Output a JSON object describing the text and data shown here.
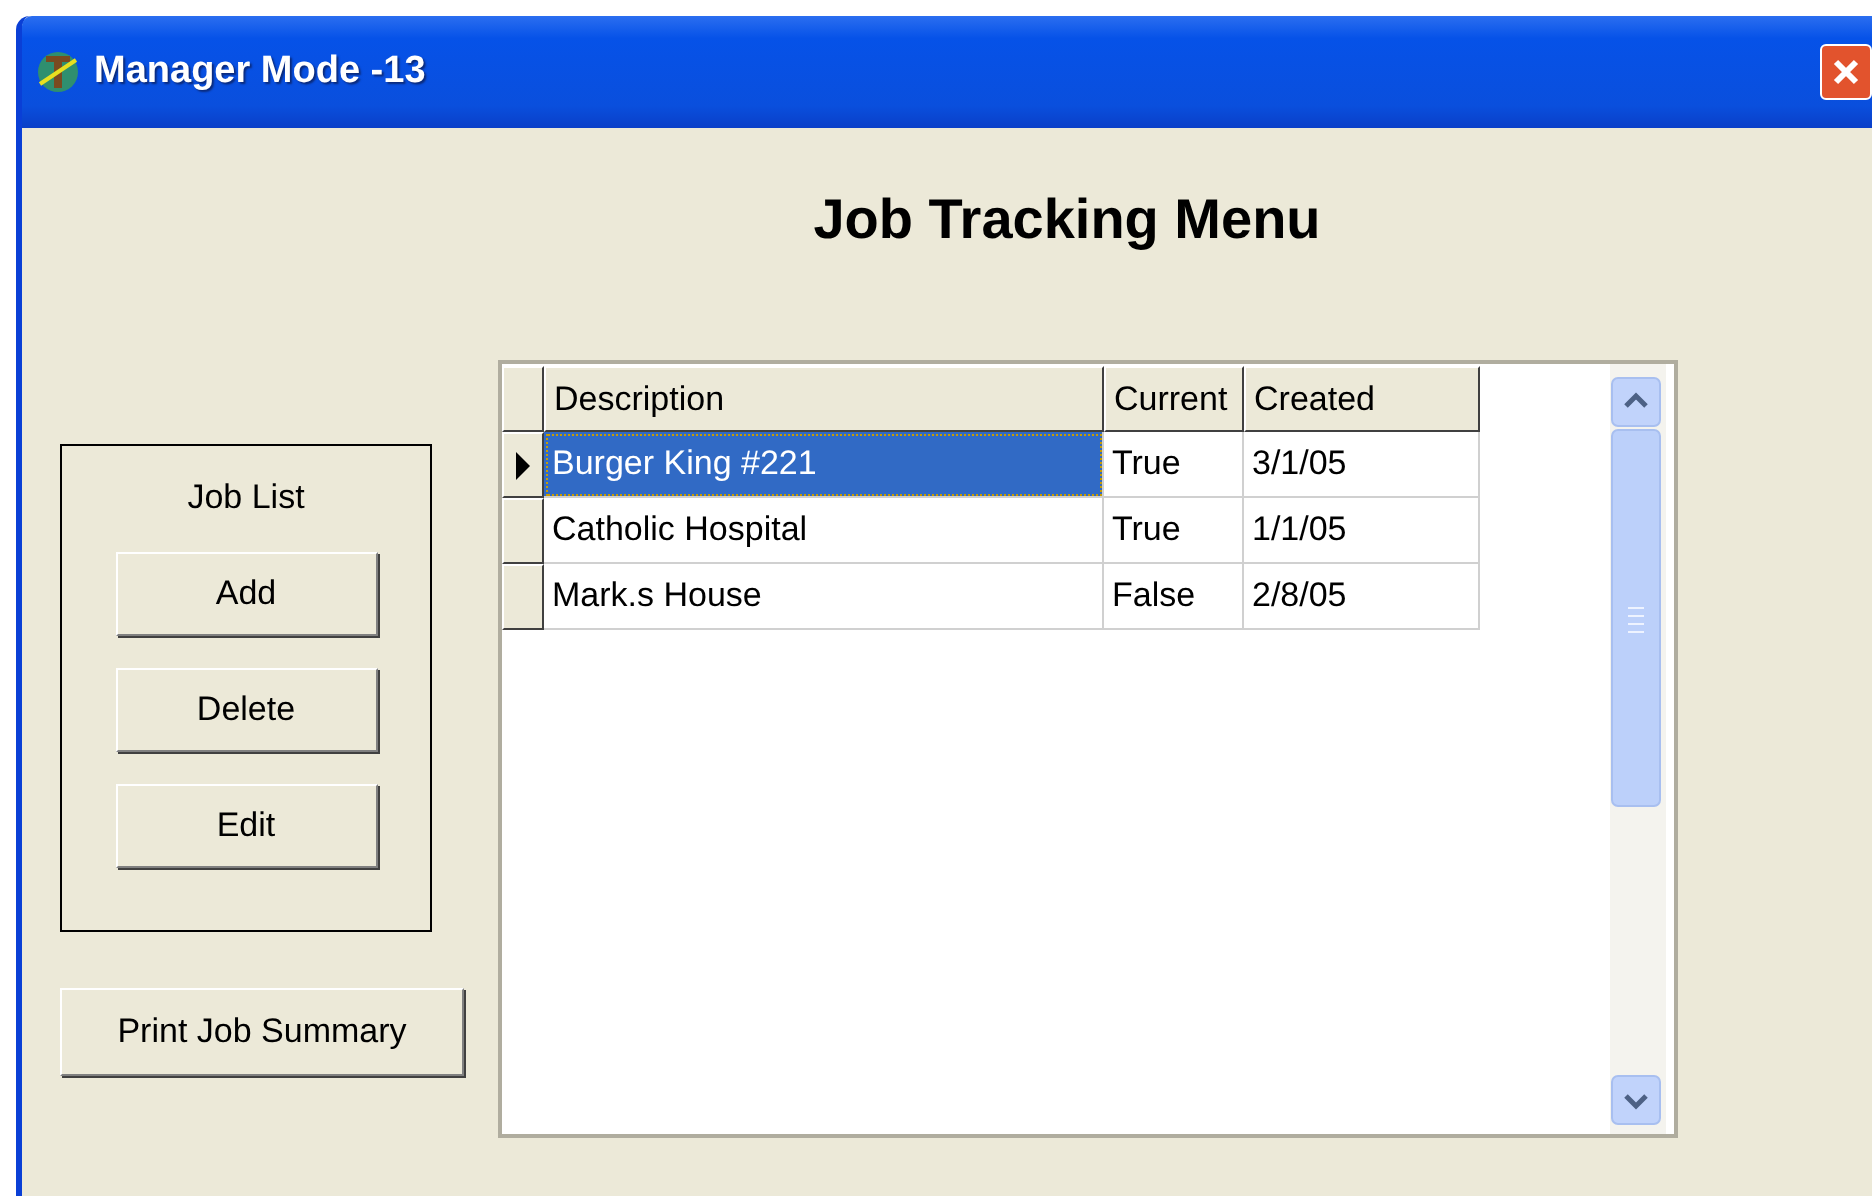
{
  "window": {
    "title": "Manager Mode -13"
  },
  "heading": "Job Tracking Menu",
  "job_list": {
    "title": "Job List",
    "buttons": [
      "Add",
      "Delete",
      "Edit"
    ]
  },
  "print_button": "Print Job Summary",
  "table": {
    "columns": [
      "Description",
      "Current",
      "Created"
    ],
    "rows": [
      {
        "cells": [
          "Burger King #221",
          "True",
          "3/1/05"
        ],
        "selected": true
      },
      {
        "cells": [
          "Catholic Hospital",
          "True",
          "1/1/05"
        ],
        "selected": false
      },
      {
        "cells": [
          "Mark.s House",
          "False",
          "2/8/05"
        ],
        "selected": false
      }
    ]
  }
}
